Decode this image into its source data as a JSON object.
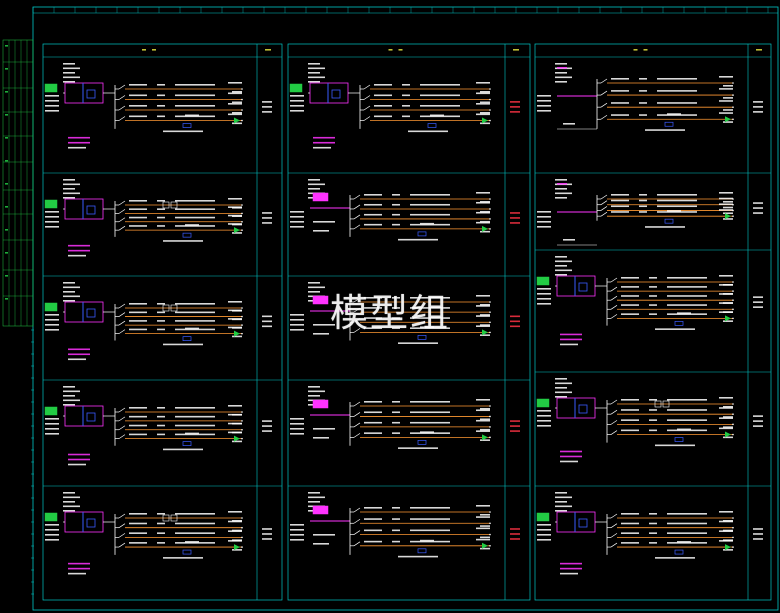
{
  "watermark": "模型组",
  "colors": {
    "frame": "#00c8c8",
    "wire": "#ff9933",
    "label": "#ffffff",
    "green": "#22cc44",
    "magenta": "#ff33ff",
    "red": "#ff3344",
    "blue": "#3a5bff",
    "yellow": "#e0e040"
  },
  "columns": [
    {
      "id": "left",
      "circuits": [
        {
          "kind": "A",
          "tag": true,
          "red_note": false
        },
        {
          "kind": "B",
          "tag": true,
          "red_note": false
        },
        {
          "kind": "B",
          "tag": true,
          "red_note": false
        },
        {
          "kind": "A",
          "tag": true,
          "red_note": false
        },
        {
          "kind": "B",
          "tag": true,
          "red_note": false
        }
      ]
    },
    {
      "id": "mid",
      "circuits": [
        {
          "kind": "A",
          "tag": true,
          "red_note": true
        },
        {
          "kind": "C",
          "tag": false,
          "red_note": true
        },
        {
          "kind": "C",
          "tag": false,
          "red_note": true
        },
        {
          "kind": "C",
          "tag": false,
          "red_note": true
        },
        {
          "kind": "C",
          "tag": false,
          "red_note": true
        }
      ]
    },
    {
      "id": "right",
      "circuits": [
        {
          "kind": "D",
          "tag": false,
          "red_note": false
        },
        {
          "kind": "D",
          "tag": false,
          "red_note": false
        },
        {
          "kind": "E",
          "tag": true,
          "red_note": false
        },
        {
          "kind": "B",
          "tag": true,
          "red_note": false
        },
        {
          "kind": "A",
          "tag": true,
          "red_note": false
        }
      ]
    }
  ]
}
